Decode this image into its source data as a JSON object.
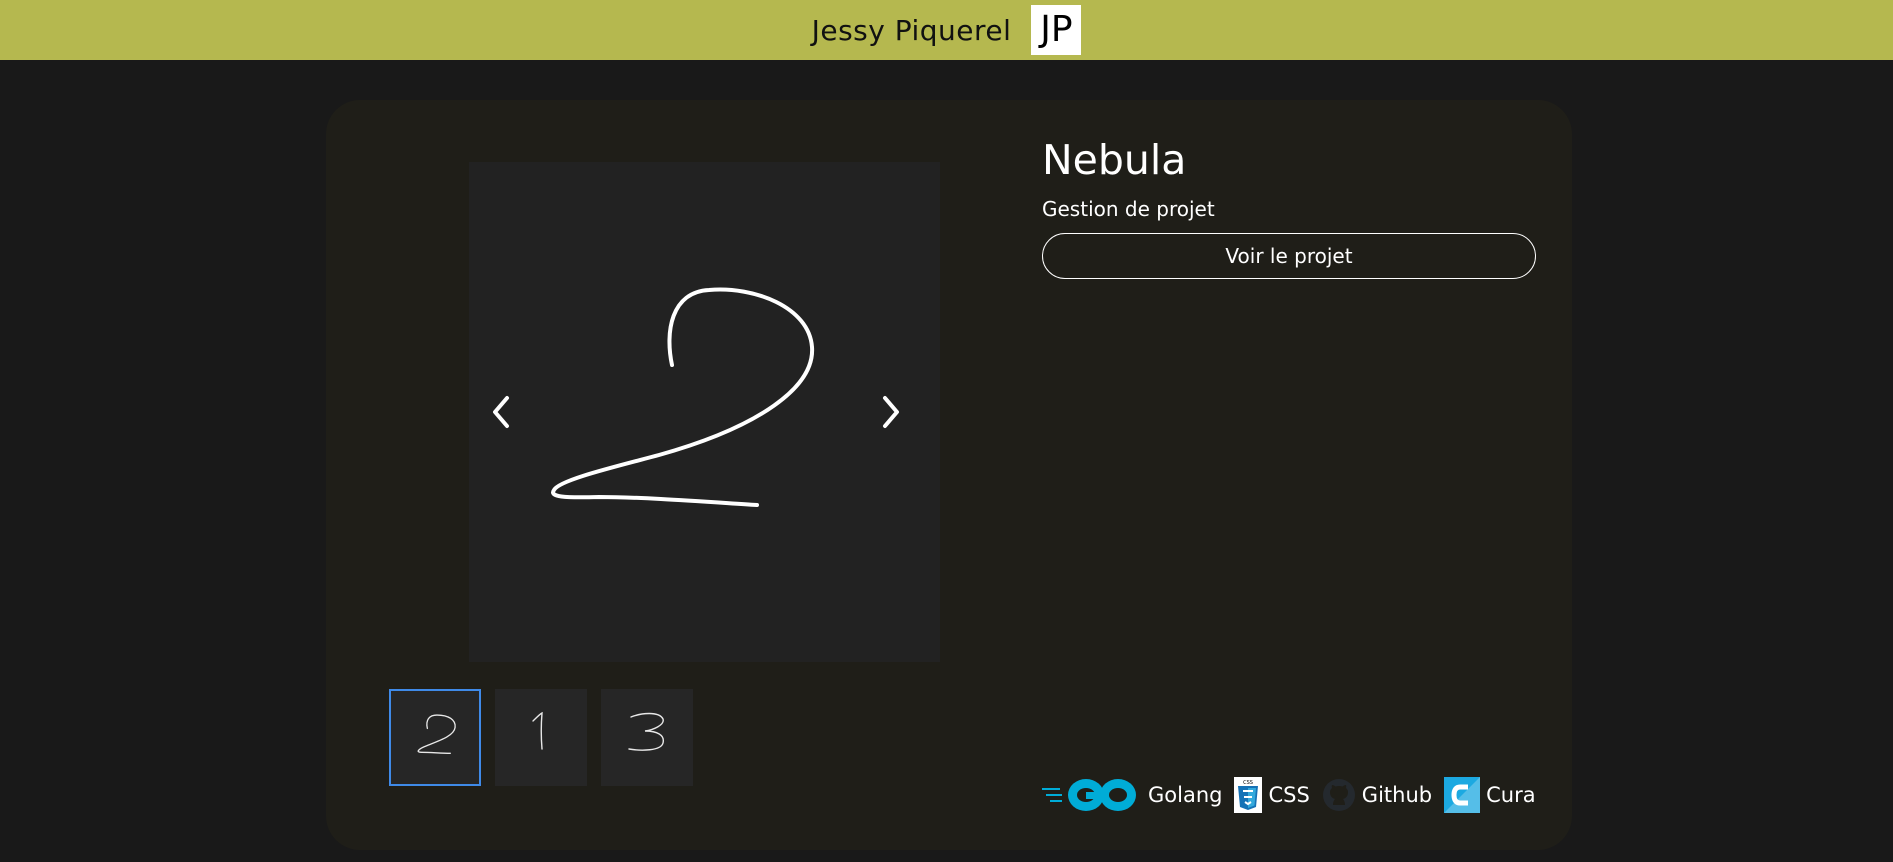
{
  "header": {
    "author": "Jessy Piquerel",
    "logo_text": "JP"
  },
  "project": {
    "title": "Nebula",
    "subtitle": "Gestion de projet",
    "view_button": "Voir le projet"
  },
  "gallery": {
    "thumbnails": [
      "2",
      "1",
      "3"
    ],
    "active_index": 0,
    "prev_icon": "chevron-left-icon",
    "next_icon": "chevron-right-icon"
  },
  "technologies": [
    {
      "name": "Golang",
      "icon": "go-logo-icon",
      "color": "#00acd7"
    },
    {
      "name": "CSS",
      "icon": "css3-icon",
      "color": "#1572b6"
    },
    {
      "name": "Github",
      "icon": "github-icon",
      "color": "#24292e"
    },
    {
      "name": "Cura",
      "icon": "cura-icon",
      "color": "#1ca9e1"
    }
  ],
  "colors": {
    "header_bg": "#b5b84f",
    "page_bg": "#191919",
    "card_bg": "#1f1e18",
    "active_thumb_border": "#3f8ae8"
  }
}
